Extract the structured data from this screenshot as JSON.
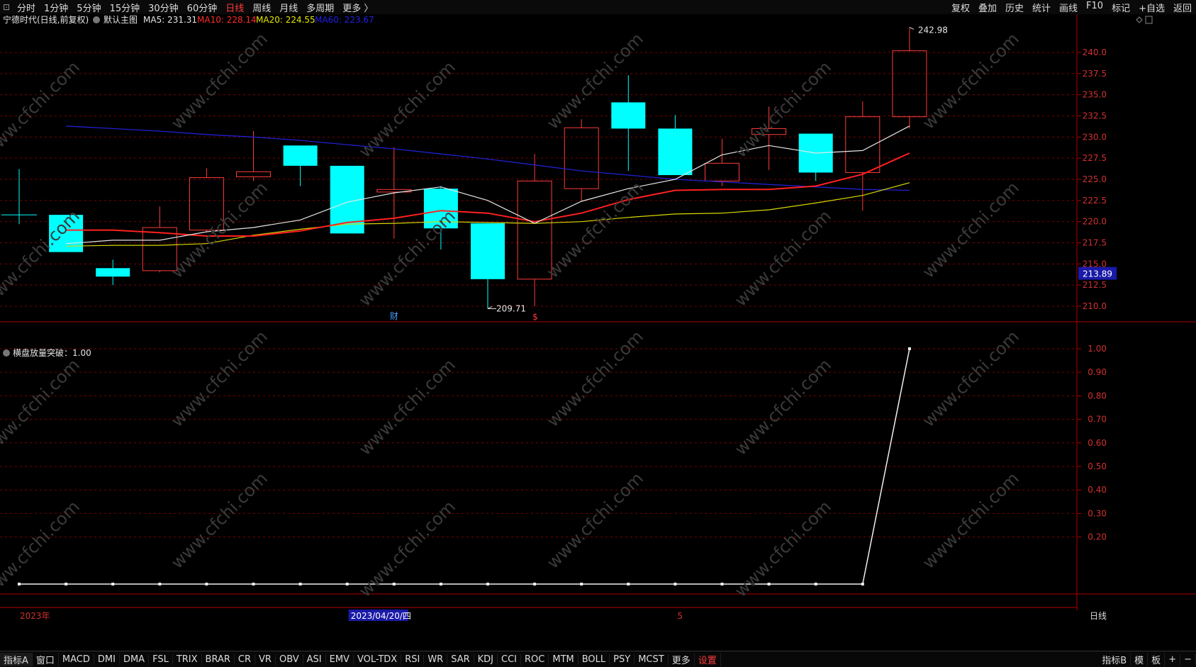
{
  "toolbar": {
    "window_icon": "window-icon",
    "periods": [
      "分时",
      "1分钟",
      "5分钟",
      "15分钟",
      "30分钟",
      "60分钟",
      "日线",
      "周线",
      "月线",
      "多周期",
      "更多 〉"
    ],
    "active_period": "日线",
    "right_items": [
      "复权",
      "叠加",
      "历史",
      "统计",
      "画线",
      "F10",
      "标记",
      "+自选",
      "返回"
    ]
  },
  "main_panel": {
    "stock_label": "宁德时代(日线,前复权)",
    "template_label": "默认主图",
    "ma_legend": [
      {
        "text": "MA5: 231.31",
        "color": "#e6e6e6"
      },
      {
        "text": "MA10: 228.14",
        "color": "#ff2a2a"
      },
      {
        "text": "MA20: 224.55",
        "color": "#e6e600"
      },
      {
        "text": "MA60: 223.67",
        "color": "#2020e0"
      }
    ],
    "high_label": "242.98",
    "low_label": "209.71",
    "price_tag": "213.89",
    "y_ticks": [
      "240.0",
      "237.5",
      "235.0",
      "232.5",
      "230.0",
      "227.5",
      "225.0",
      "222.5",
      "220.0",
      "217.5",
      "215.0",
      "212.5",
      "210.0"
    ],
    "markers": [
      {
        "text": "财",
        "color": "#4aa0ff"
      },
      {
        "text": "$",
        "color": "#ff3b3b"
      }
    ]
  },
  "sub_panel": {
    "title": "横盘放量突破：1.00",
    "y_ticks": [
      "1.00",
      "0.90",
      "0.80",
      "0.70",
      "0.60",
      "0.50",
      "0.40",
      "0.30",
      "0.20"
    ]
  },
  "x_axis": {
    "year_label": "2023年",
    "cursor_date": "2023/04/20/四",
    "month_label": "5",
    "period_label": "日线"
  },
  "bottom_tabs": {
    "items": [
      "指标A",
      "窗口",
      "MACD",
      "DMI",
      "DMA",
      "FSL",
      "TRIX",
      "BRAR",
      "CR",
      "VR",
      "OBV",
      "ASI",
      "EMV",
      "VOL-TDX",
      "RSI",
      "WR",
      "SAR",
      "KDJ",
      "CCI",
      "ROC",
      "MTM",
      "BOLL",
      "PSY",
      "MCST",
      "更多",
      "设置"
    ],
    "highlight": "设置",
    "right_items": [
      "指标B",
      "模",
      "板",
      "+",
      "−"
    ]
  },
  "watermark": "www.cfchi.com",
  "colors": {
    "up": "#ff3b3b",
    "down": "#00ffff",
    "ma5": "#e6e6e6",
    "ma10": "#ff2020",
    "ma20": "#d8d800",
    "ma60": "#2020d0",
    "grid": "#7a0000",
    "axis": "#b00000"
  },
  "chart_data": {
    "type": "candlestick",
    "candles": [
      {
        "o": 220.8,
        "h": 226.2,
        "l": 219.7,
        "c": 220.8
      },
      {
        "o": 220.8,
        "h": 220.8,
        "l": 216.4,
        "c": 216.4
      },
      {
        "o": 214.5,
        "h": 215.5,
        "l": 212.5,
        "c": 213.5
      },
      {
        "o": 214.2,
        "h": 221.8,
        "l": 214.0,
        "c": 219.3
      },
      {
        "o": 219.0,
        "h": 226.3,
        "l": 218.7,
        "c": 225.2
      },
      {
        "o": 225.3,
        "h": 230.7,
        "l": 224.8,
        "c": 225.9
      },
      {
        "o": 229.0,
        "h": 229.0,
        "l": 224.2,
        "c": 226.6
      },
      {
        "o": 226.6,
        "h": 226.6,
        "l": 218.6,
        "c": 218.6
      },
      {
        "o": 223.5,
        "h": 228.8,
        "l": 218.0,
        "c": 223.8
      },
      {
        "o": 223.9,
        "h": 224.2,
        "l": 216.7,
        "c": 219.2
      },
      {
        "o": 219.8,
        "h": 219.8,
        "l": 209.71,
        "c": 213.2
      },
      {
        "o": 213.2,
        "h": 228.0,
        "l": 210.0,
        "c": 224.8
      },
      {
        "o": 223.9,
        "h": 232.1,
        "l": 222.5,
        "c": 231.1
      },
      {
        "o": 234.1,
        "h": 237.3,
        "l": 226.0,
        "c": 231.0
      },
      {
        "o": 231.0,
        "h": 232.6,
        "l": 225.5,
        "c": 225.5
      },
      {
        "o": 224.8,
        "h": 229.8,
        "l": 224.2,
        "c": 226.9
      },
      {
        "o": 230.3,
        "h": 233.6,
        "l": 226.1,
        "c": 231.0
      },
      {
        "o": 230.4,
        "h": 230.4,
        "l": 224.8,
        "c": 225.8
      },
      {
        "o": 225.8,
        "h": 234.2,
        "l": 221.3,
        "c": 232.4
      },
      {
        "o": 232.4,
        "h": 242.98,
        "l": 231.0,
        "c": 240.2
      }
    ],
    "ma5": [
      null,
      217.4,
      217.8,
      217.8,
      218.8,
      219.3,
      220.2,
      222.3,
      223.4,
      224.1,
      222.5,
      219.8,
      222.4,
      223.9,
      225.0,
      227.9,
      229.0,
      228.1,
      228.4,
      231.3
    ],
    "ma10": [
      null,
      219.0,
      219.0,
      218.7,
      218.3,
      218.3,
      218.9,
      219.9,
      220.4,
      221.3,
      221.0,
      220.0,
      221.0,
      222.6,
      223.7,
      223.8,
      223.8,
      224.2,
      225.6,
      228.1
    ],
    "ma20": [
      null,
      217.1,
      217.2,
      217.2,
      217.4,
      218.4,
      219.1,
      219.7,
      219.8,
      220.0,
      219.9,
      219.8,
      220.0,
      220.5,
      220.9,
      221.0,
      221.4,
      222.2,
      223.1,
      224.6
    ],
    "ma60": [
      null,
      231.3,
      231.0,
      230.7,
      230.3,
      230.0,
      229.6,
      229.1,
      228.6,
      228.0,
      227.4,
      226.7,
      226.0,
      225.5,
      225.0,
      224.7,
      224.4,
      224.1,
      223.8,
      223.7
    ],
    "indicator": [
      0,
      0,
      0,
      0,
      0,
      0,
      0,
      0,
      0,
      0,
      0,
      0,
      0,
      0,
      0,
      0,
      0,
      0,
      0,
      1.0
    ],
    "price_ylim": [
      209,
      243
    ],
    "indicator_ylim": [
      0,
      1.0
    ]
  }
}
